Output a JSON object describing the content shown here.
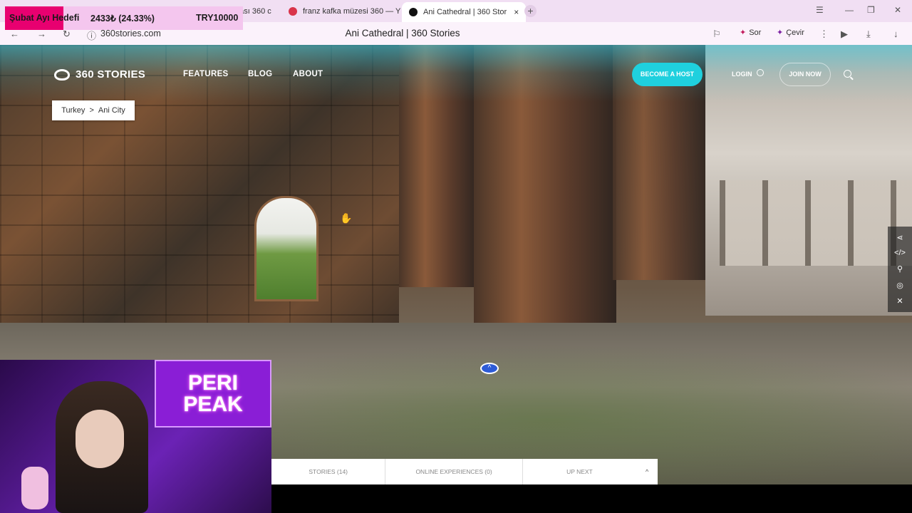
{
  "browser": {
    "tabs": [
      {
        "label": "dası 360 c",
        "active": false
      },
      {
        "label": "franz kafka müzesi 360 — Y",
        "active": false
      },
      {
        "label": "Ani Cathedral | 360 Stor",
        "active": true
      }
    ],
    "new_tab": "+",
    "close_tab": "×",
    "url": "360stories.com",
    "page_title": "Ani Cathedral | 360 Stories",
    "actions": {
      "ask": "Sor",
      "translate": "Çevir"
    }
  },
  "overlay": {
    "goal_label": "Şubat Ayı Hedefi",
    "progress": "2433₺ (24.33%)",
    "target": "TRY10000"
  },
  "site": {
    "brand": "360 STORIES",
    "nav": [
      "FEATURES",
      "BLOG",
      "ABOUT"
    ],
    "become_host": "BECOME A HOST",
    "login": "LOGIN",
    "join_now": "JOIN NOW"
  },
  "breadcrumb": {
    "country": "Turkey",
    "separator": ">",
    "city": "Ani City"
  },
  "bottom_bar": {
    "stories": "STORIES (14)",
    "online_experiences": "ONLINE EXPERIENCES (0)",
    "up_next": "UP NEXT"
  },
  "webcam": {
    "sign_line1": "PERI",
    "sign_line2": "PEAK"
  },
  "colors": {
    "accent": "#1fd0de",
    "tab_bg": "#f1dff3",
    "overlay_goal": "#e80070"
  }
}
